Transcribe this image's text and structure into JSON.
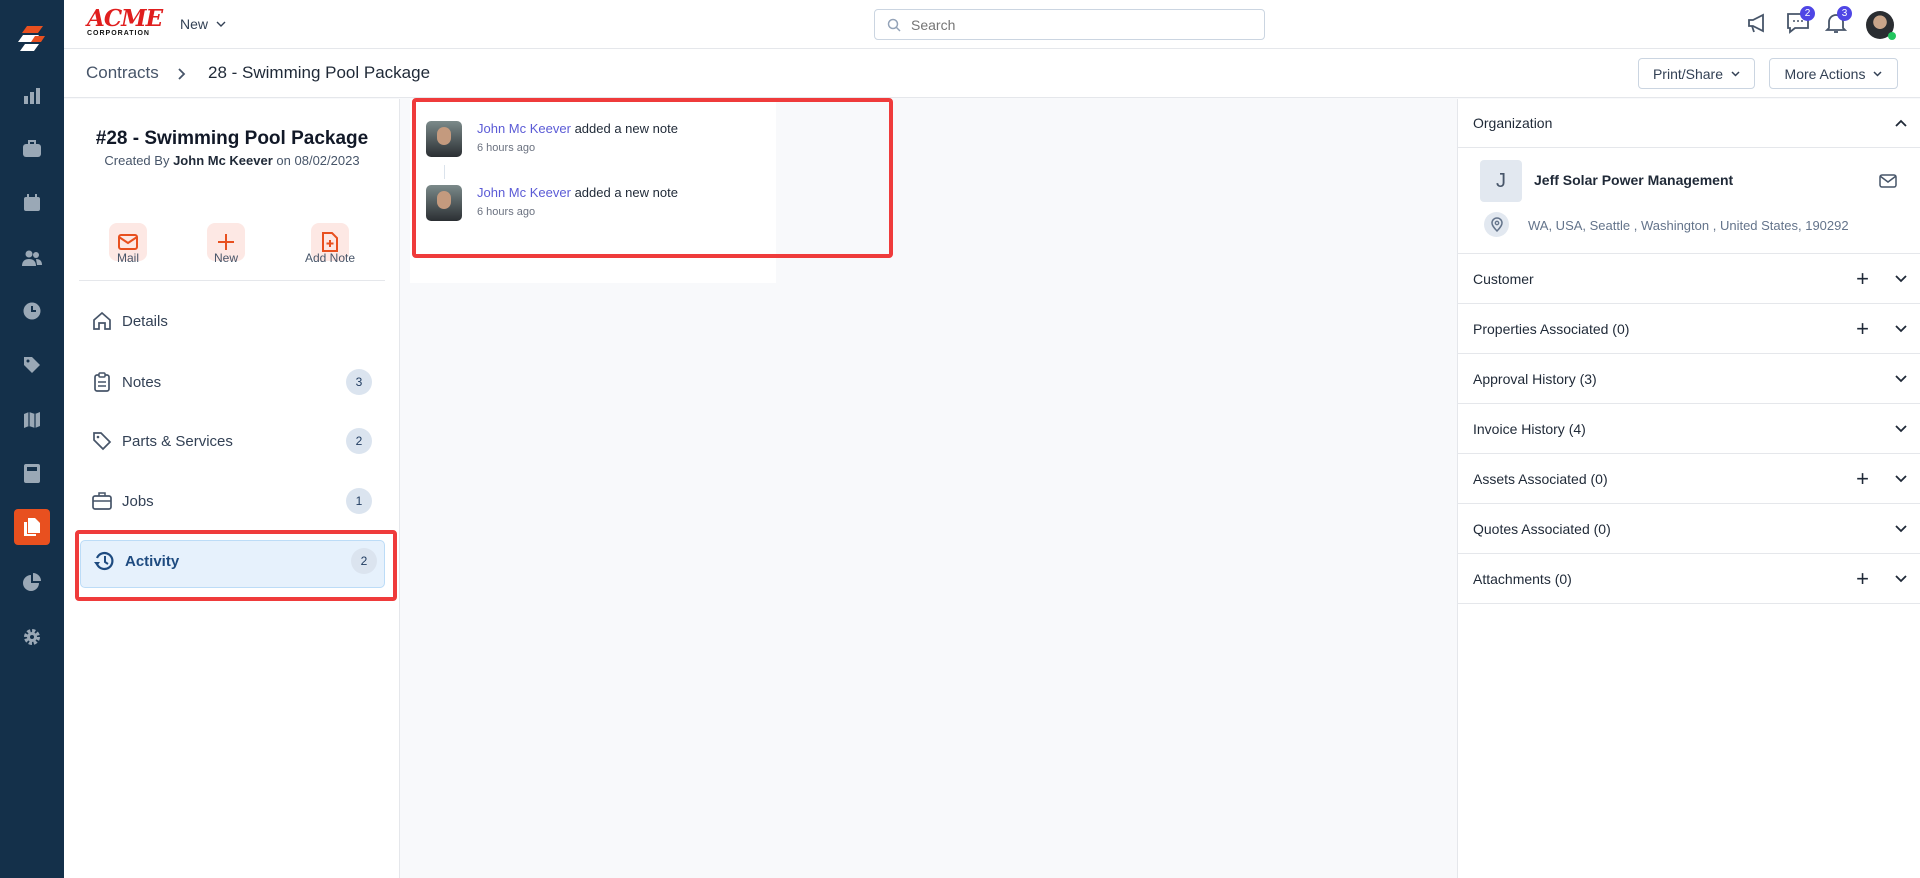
{
  "app": {
    "logo_text": "ACME",
    "logo_sub": "CORPORATION",
    "new_label": "New",
    "search_placeholder": "Search",
    "chat_count": "2",
    "notif_count": "3"
  },
  "breadcrumb": {
    "root": "Contracts",
    "current": "28 - Swimming Pool Package"
  },
  "actions": {
    "print_share": "Print/Share",
    "more_actions": "More Actions"
  },
  "contract": {
    "title": "#28 - Swimming Pool Package",
    "created_prefix": "Created By",
    "created_by": "John Mc Keever",
    "created_on_prefix": "on",
    "created_date": "08/02/2023"
  },
  "quick_actions": [
    {
      "label": "Mail",
      "icon": "mail-icon"
    },
    {
      "label": "New",
      "icon": "plus-icon"
    },
    {
      "label": "Add Note",
      "icon": "add-note-icon"
    }
  ],
  "nav": [
    {
      "label": "Details",
      "count": null
    },
    {
      "label": "Notes",
      "count": "3"
    },
    {
      "label": "Parts & Services",
      "count": "2"
    },
    {
      "label": "Jobs",
      "count": "1"
    },
    {
      "label": "Activity",
      "count": "2"
    }
  ],
  "activity": [
    {
      "user": "John Mc Keever",
      "action": "added a new note",
      "time": "6 hours ago"
    },
    {
      "user": "John Mc Keever",
      "action": "added a new note",
      "time": "6 hours ago"
    }
  ],
  "organization": {
    "header": "Organization",
    "initial": "J",
    "name": "Jeff Solar Power Management",
    "address": "WA, USA, Seattle , Washington , United States, 190292"
  },
  "sections": [
    {
      "label": "Customer",
      "add": true
    },
    {
      "label": "Properties Associated (0)",
      "add": true
    },
    {
      "label": "Approval History (3)",
      "add": false
    },
    {
      "label": "Invoice History (4)",
      "add": false
    },
    {
      "label": "Assets Associated (0)",
      "add": true
    },
    {
      "label": "Quotes Associated (0)",
      "add": false
    },
    {
      "label": "Attachments (0)",
      "add": true
    }
  ],
  "colors": {
    "sidebar": "#14304a",
    "accent": "#e8501f",
    "link": "#5b5bd6",
    "highlight": "#ef3b3b"
  }
}
